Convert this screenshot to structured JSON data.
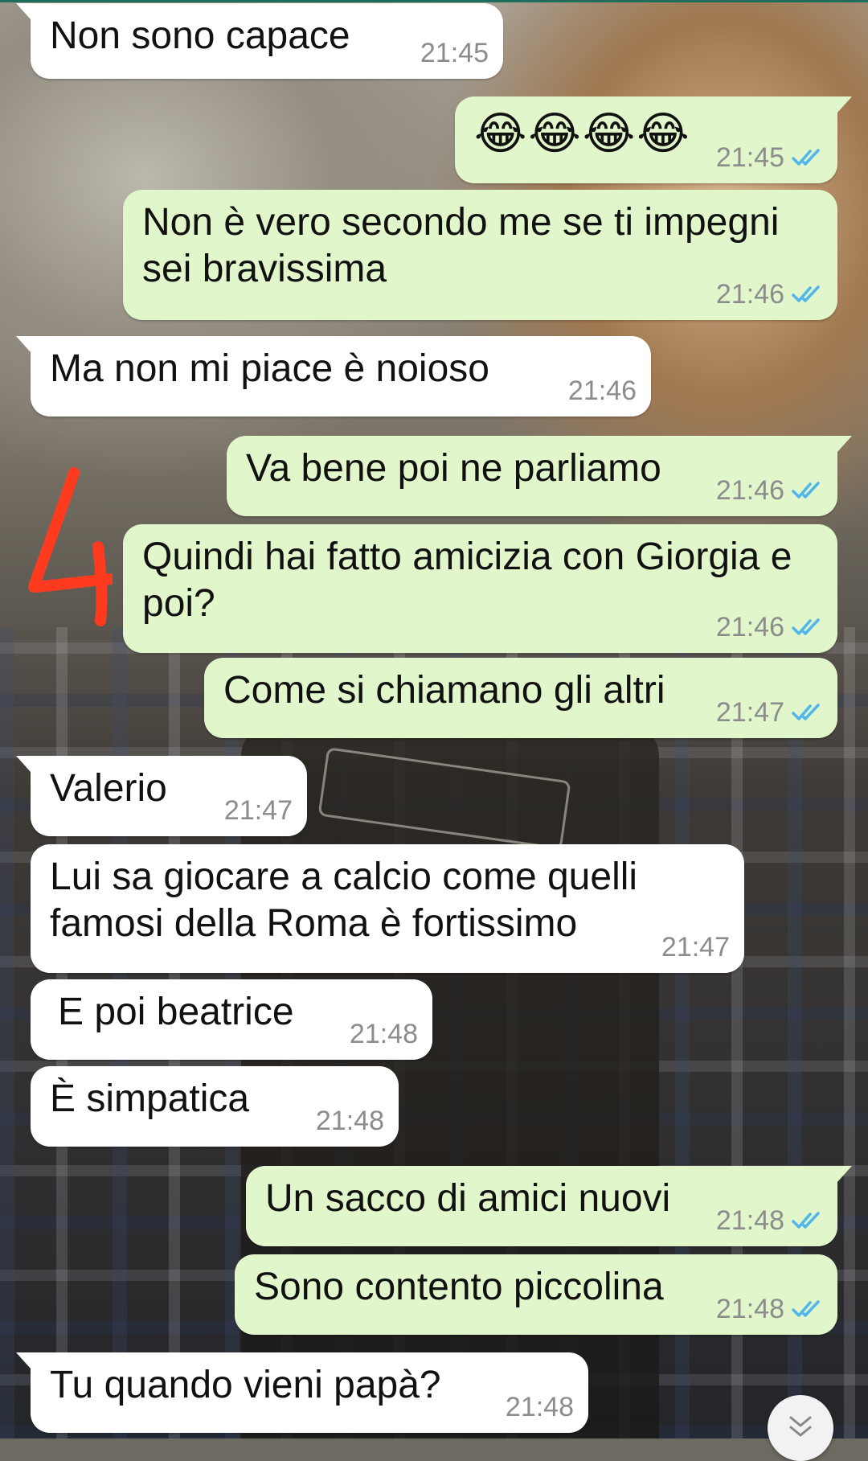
{
  "messages": [
    {
      "id": "m1",
      "dir": "in",
      "text": "Non sono capace",
      "time": "21:45"
    },
    {
      "id": "m2",
      "dir": "out",
      "text": "😂😂😂😂",
      "time": "21:45",
      "read": true
    },
    {
      "id": "m3",
      "dir": "out",
      "text": "Non è vero secondo me se ti impegni sei bravissima",
      "time": "21:46",
      "read": true
    },
    {
      "id": "m4",
      "dir": "in",
      "text": "Ma non mi piace è noioso",
      "time": "21:46"
    },
    {
      "id": "m5",
      "dir": "out",
      "text": "Va bene poi ne parliamo",
      "time": "21:46",
      "read": true
    },
    {
      "id": "m6",
      "dir": "out",
      "text": "Quindi hai fatto amicizia con Giorgia e poi?",
      "time": "21:46",
      "read": true
    },
    {
      "id": "m7",
      "dir": "out",
      "text": "Come si chiamano gli altri",
      "time": "21:47",
      "read": true
    },
    {
      "id": "m8",
      "dir": "in",
      "text": "Valerio",
      "time": "21:47"
    },
    {
      "id": "m9",
      "dir": "in",
      "text": "Lui sa giocare a calcio come quelli famosi della Roma è fortissimo",
      "time": "21:47"
    },
    {
      "id": "m10",
      "dir": "in",
      "text": "E poi beatrice",
      "time": "21:48"
    },
    {
      "id": "m11",
      "dir": "in",
      "text": "È simpatica",
      "time": "21:48"
    },
    {
      "id": "m12",
      "dir": "out",
      "text": "Un sacco di amici nuovi",
      "time": "21:48",
      "read": true
    },
    {
      "id": "m13",
      "dir": "out",
      "text": "Sono contento piccolina",
      "time": "21:48",
      "read": true
    },
    {
      "id": "m14",
      "dir": "in",
      "text": "Tu quando vieni papà?",
      "time": "21:48"
    }
  ],
  "annotation": {
    "text": "4",
    "color": "#ff3b1f"
  },
  "colors": {
    "incoming_bubble": "#ffffff",
    "outgoing_bubble": "#e1f6cb",
    "read_ticks": "#4fb6ec",
    "timestamp": "#8c8c8c"
  },
  "icons": {
    "read_receipt": "double-check-icon",
    "scroll_down": "chevron-double-down-icon"
  }
}
